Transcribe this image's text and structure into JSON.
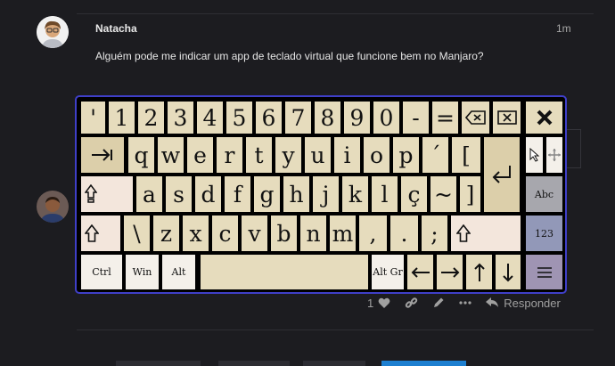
{
  "post1": {
    "username": "Natacha",
    "time": "1m",
    "text": "Alguém pode me indicar um app de teclado virtual que funcione bem no Manjaro?"
  },
  "post2": {
    "actions": {
      "like_count": "1",
      "reply_label": "Responder"
    }
  },
  "keyboard": {
    "row1": [
      "'",
      "1",
      "2",
      "3",
      "4",
      "5",
      "6",
      "7",
      "8",
      "9",
      "0",
      "-",
      "="
    ],
    "row2": [
      "q",
      "w",
      "e",
      "r",
      "t",
      "y",
      "u",
      "i",
      "o",
      "p",
      "´",
      "["
    ],
    "row3": [
      "a",
      "s",
      "d",
      "f",
      "g",
      "h",
      "j",
      "k",
      "l",
      "ç",
      "~",
      "]"
    ],
    "row4": [
      "\\",
      "z",
      "x",
      "c",
      "v",
      "b",
      "n",
      "m",
      ",",
      ".",
      ";"
    ],
    "labels": {
      "ctrl": "Ctrl",
      "win": "Win",
      "alt": "Alt",
      "altgr": "Alt Gr",
      "abc": "Abc",
      "num": "123"
    }
  },
  "colors": {
    "background": "#1c1c20",
    "key": "#e6dcbd",
    "key_light": "#f3e6dc",
    "keyboard_border": "#3f3fc8",
    "accent_tab": "#1d7fd0"
  }
}
